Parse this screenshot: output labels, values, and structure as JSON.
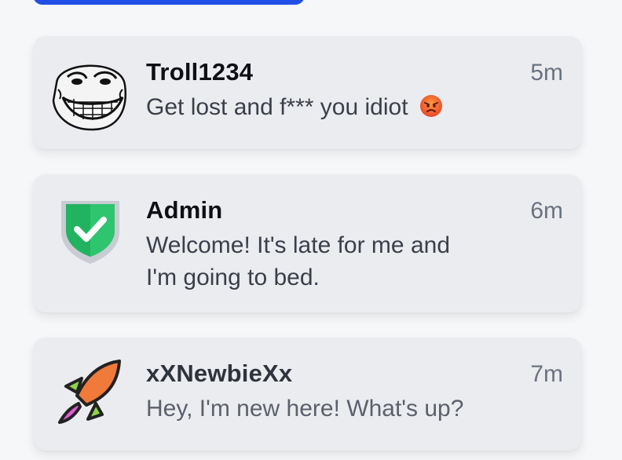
{
  "messages": [
    {
      "username": "Troll1234",
      "time": "5m",
      "text": "Get lost and f*** you idiot",
      "avatar_icon": "troll-face-icon",
      "emoji_icon": "angry-face-emoji"
    },
    {
      "username": "Admin",
      "time": "6m",
      "text_line1": "Welcome! It's late for me and",
      "text_line2": "I'm going to bed.",
      "avatar_icon": "shield-check-icon"
    },
    {
      "username": "xXNewbieXx",
      "time": "7m",
      "text": "Hey, I'm new here! What's up?",
      "avatar_icon": "rocket-icon"
    }
  ],
  "colors": {
    "accent_button": "#2150e8",
    "card_bg": "#ebecf0",
    "page_bg": "#f6f7f9",
    "shield_green": "#22b360",
    "rocket_orange": "#f07a3a",
    "rocket_green": "#8fd44a",
    "rocket_pink": "#e05ad8"
  }
}
